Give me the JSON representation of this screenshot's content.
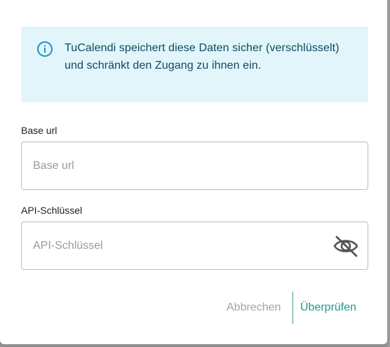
{
  "info": {
    "text": "TuCalendi speichert diese Daten sicher (verschlüsselt) und schränkt den Zugang zu ihnen ein.",
    "icon": "info-icon"
  },
  "fields": {
    "base_url": {
      "label": "Base url",
      "placeholder": "Base url",
      "value": ""
    },
    "api_key": {
      "label": "API-Schlüssel",
      "placeholder": "API-Schlüssel",
      "value": "",
      "toggle_icon": "eye-off-icon"
    }
  },
  "actions": {
    "cancel_label": "Abbrechen",
    "verify_label": "Überprüfen"
  },
  "colors": {
    "info_bg": "#e2f5fa",
    "info_text": "#0b4a5e",
    "accent": "#1a9d86",
    "muted": "#a3a3a3"
  }
}
